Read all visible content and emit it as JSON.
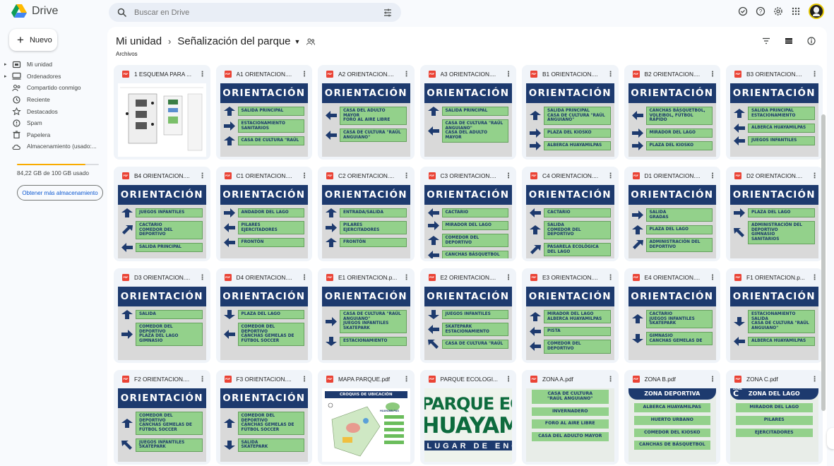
{
  "app": {
    "name": "Drive"
  },
  "search": {
    "placeholder": "Buscar en Drive"
  },
  "new_button": {
    "label": "Nuevo"
  },
  "sidebar": {
    "items": [
      {
        "label": "Mi unidad",
        "icon": "my-drive-icon",
        "caret": true
      },
      {
        "label": "Ordenadores",
        "icon": "computers-icon",
        "caret": true
      },
      {
        "label": "Compartido conmigo",
        "icon": "shared-icon",
        "caret": false
      },
      {
        "label": "Reciente",
        "icon": "clock-icon",
        "caret": false
      },
      {
        "label": "Destacados",
        "icon": "star-icon",
        "caret": false
      },
      {
        "label": "Spam",
        "icon": "spam-icon",
        "caret": false
      },
      {
        "label": "Papelera",
        "icon": "trash-icon",
        "caret": false
      },
      {
        "label": "Almacenamiento (usado:...",
        "icon": "cloud-icon",
        "caret": false
      }
    ],
    "storage_text": "84,22 GB de 100 GB usado",
    "storage_used_fraction": 0.84,
    "get_storage_label": "Obtener más almacenamiento"
  },
  "breadcrumb": {
    "root": "Mi unidad",
    "current": "Señalización del parque",
    "separator": "›"
  },
  "section_label": "Archivos",
  "colors": {
    "accent": "#0b57d0",
    "pdf": "#ea4335",
    "sign_header": "#1d3a6e",
    "sign_box": "#93d18b",
    "storage": "#f9ab00"
  },
  "files": [
    {
      "title": "1 ESQUEMA PARA ...",
      "kind": "diagram"
    },
    {
      "title": "A1 ORIENTACION....",
      "kind": "sign",
      "rows": [
        [
          "up",
          "SALIDA PRINCIPAL"
        ],
        [
          "right",
          "ESTACIONAMIENTO\nSANITARIOS"
        ],
        [
          "up",
          "CASA DE CULTURA \"RAÚL"
        ]
      ]
    },
    {
      "title": "A2 ORIENTACION....",
      "kind": "sign",
      "rows": [
        [
          "left",
          "CASA DEL ADULTO MAYOR\nFORO AL AIRE LIBRE"
        ],
        [
          "left",
          "CASA DE CULTURA \"RAÚL\nANGUIANO\""
        ]
      ]
    },
    {
      "title": "A3 ORIENTACION....",
      "kind": "sign",
      "rows": [
        [
          "up",
          "SALIDA PRINCIPAL"
        ],
        [
          "left",
          "CASA DE CULTURA \"RAÚL\nANGUIANO\"\nCASA DEL ADULTO MAYOR"
        ]
      ]
    },
    {
      "title": "B1 ORIENTACION....",
      "kind": "sign",
      "rows": [
        [
          "up",
          "SALIDA PRINCIPAL\nCASA DE CULTURA \"RAÚL\nANGUIANO\""
        ],
        [
          "right",
          "PLAZA DEL KIOSKO"
        ],
        [
          "right",
          "ALBERCA HUAYAMILPAS"
        ]
      ]
    },
    {
      "title": "B2 ORIENTACION....",
      "kind": "sign",
      "rows": [
        [
          "left",
          "CANCHAS BÁSQUETBOL,\nVOLEIBOL, FÚTBOL\nRÁPIDO"
        ],
        [
          "right",
          "MIRADOR DEL LAGO"
        ],
        [
          "right",
          "PLAZA DEL KIOSKO"
        ]
      ]
    },
    {
      "title": "B3 ORIENTACION....",
      "kind": "sign",
      "rows": [
        [
          "up",
          "SALIDA PRINCIPAL\nESTACIONAMIENTO"
        ],
        [
          "left",
          "ALBERCA HUAYAMILPAS"
        ],
        [
          "left",
          "JUEGOS INFANTILES"
        ]
      ]
    },
    {
      "title": "B4 ORIENTACION....",
      "kind": "sign",
      "rows": [
        [
          "up",
          "JUEGOS INFANTILES"
        ],
        [
          "upright",
          "CACTARIO\nCOMEDOR DEL DEPORTIVO"
        ],
        [
          "left",
          "SALIDA PRINCIPAL"
        ]
      ]
    },
    {
      "title": "C1 ORIENTACION....",
      "kind": "sign",
      "rows": [
        [
          "right",
          "ANDADOR DEL LAGO"
        ],
        [
          "left",
          "PILARES\nEJERCITADORES"
        ],
        [
          "left",
          "FRONTÓN"
        ]
      ]
    },
    {
      "title": "C2 ORIENTACION....",
      "kind": "sign",
      "rows": [
        [
          "up",
          "ENTRADA/SALIDA"
        ],
        [
          "right",
          "PILARES\nEJERCITADORES"
        ],
        [
          "up",
          "FRONTÓN"
        ]
      ]
    },
    {
      "title": "C3 ORIENTACION....",
      "kind": "sign",
      "rows": [
        [
          "left",
          "CACTARIO"
        ],
        [
          "right",
          "MIRADOR DEL LAGO"
        ],
        [
          "up",
          "COMEDOR DEL DEPORTIVO"
        ],
        [
          "left",
          "CANCHAS BÁSQUETBOL"
        ]
      ]
    },
    {
      "title": "C4 ORIENTACION....",
      "kind": "sign",
      "rows": [
        [
          "left",
          "CACTARIO"
        ],
        [
          "up",
          "SALIDA\nCOMEDOR DEL DEPORTIVO"
        ],
        [
          "upright",
          "PASARELA ECOLÓGICA\nDEL LAGO"
        ]
      ]
    },
    {
      "title": "D1 ORIENTACION....",
      "kind": "sign",
      "rows": [
        [
          "right",
          "SALIDA\nGRADAS"
        ],
        [
          "up",
          "PLAZA DEL LAGO"
        ],
        [
          "upright",
          "ADMINISTRACIÓN DEL\nDEPORTIVO"
        ]
      ]
    },
    {
      "title": "D2 ORIENTACION....",
      "kind": "sign",
      "rows": [
        [
          "right",
          "PLAZA DEL LAGO"
        ],
        [
          "upleft",
          "ADMINISTRACIÓN DEL\nDEPORTIVO\nGIMNASIO\nSANITARIOS"
        ]
      ]
    },
    {
      "title": "D3 ORIENTACION....",
      "kind": "sign",
      "rows": [
        [
          "up",
          "SALIDA"
        ],
        [
          "right",
          "COMEDOR DEL DEPORTIVO\nPLAZA DEL LAGO\nGIMNASIO"
        ]
      ]
    },
    {
      "title": "D4 ORIENTACION....",
      "kind": "sign",
      "rows": [
        [
          "down",
          "PLAZA DEL LAGO"
        ],
        [
          "left",
          "COMEDOR DEL DEPORTIVO\nCANCHAS GEMELAS DE\nFÚTBOL SOCCER"
        ]
      ]
    },
    {
      "title": "E1 ORIENTACION.p...",
      "kind": "sign",
      "rows": [
        [
          "right",
          "CASA DE CULTURA \"RAÚL\nANGUIANO\"\nJUEGOS INFANTILES\nSKATEPARK"
        ],
        [
          "down",
          "ESTACIONAMIENTO"
        ]
      ]
    },
    {
      "title": "E2 ORIENTACION....",
      "kind": "sign",
      "rows": [
        [
          "down",
          "JUEGOS INFANTILES"
        ],
        [
          "left",
          "SKATEPARK\nESTACIONAMIENTO"
        ],
        [
          "upleft",
          "CASA DE CULTURA \"RAÚL"
        ]
      ]
    },
    {
      "title": "E3 ORIENTACION....",
      "kind": "sign",
      "rows": [
        [
          "up",
          "MIRADOR DEL LAGO\nALBERCA HUAYAMILPAS"
        ],
        [
          "left",
          "PISTA"
        ],
        [
          "left",
          "COMEDOR DEL DEPORTIVO"
        ]
      ]
    },
    {
      "title": "E4 ORIENTACION....",
      "kind": "sign",
      "rows": [
        [
          "up",
          "CACTARIO\nJUEGOS INFANTILES\nSKATEPARK"
        ],
        [
          "down",
          "GIMNASIO\nCANCHAS GEMELAS DE"
        ]
      ]
    },
    {
      "title": "F1 ORIENTACION.p...",
      "kind": "sign",
      "rows": [
        [
          "down",
          "ESTACIONAMIENTO\nSALIDA\nCASA DE CULTURA \"RAÚL\nANGUIANO\""
        ],
        [
          "left",
          "ALBERCA HUAYAMILPAS"
        ]
      ]
    },
    {
      "title": "F2 ORIENTACION....",
      "kind": "sign",
      "rows": [
        [
          "up",
          "COMEDOR DEL DEPORTIVO\nCANCHAS GEMELAS DE\nFÚTBOL SOCCER"
        ],
        [
          "upleft",
          "JUEGOS INFANTILES\nSKATEPARK"
        ]
      ]
    },
    {
      "title": "F3 ORIENTACION....",
      "kind": "sign",
      "rows": [
        [
          "up",
          "COMEDOR DEL DEPORTIVO\nCANCHAS GEMELAS DE\nFÚTBOL SOCCER"
        ],
        [
          "down",
          "SALIDA\nSKATEPARK"
        ]
      ]
    },
    {
      "title": "MAPA PARQUE.pdf",
      "kind": "map",
      "map_title": "CROQUIS DE UBICACIÓN",
      "map_subtitle": "HUAYAMILPAS"
    },
    {
      "title": "PARQUE ECOLOGI...",
      "kind": "poster",
      "lines": [
        "PARQUE ECOL",
        "HUAYAMIL",
        "LUGAR DE ENCU"
      ]
    },
    {
      "title": "ZONA A.pdf",
      "kind": "zone",
      "items": [
        "CASA DE CULTURA\n\"RAÚL ANGUIANO\"",
        "INVERNADERO",
        "FORO AL AIRE LIBRE",
        "CASA DEL ADULTO MAYOR"
      ]
    },
    {
      "title": "ZONA B.pdf",
      "kind": "zone",
      "header": "ZONA DEPORTIVA",
      "items": [
        "ALBERCA HUAYAMILPAS",
        "HUERTO URBANO",
        "COMEDOR DEL KIOSKO",
        "CANCHAS DE BÁSQUETBOL"
      ]
    },
    {
      "title": "ZONA C.pdf",
      "kind": "zone",
      "header": "ZONA DEL LAGO",
      "zone_letter": "C",
      "zone_word": "ZONA",
      "items": [
        "MIRADOR DEL LAGO",
        "PILARES",
        "EJERCITADORES"
      ]
    }
  ],
  "sign_header_text": "ORIENTACIÓN"
}
